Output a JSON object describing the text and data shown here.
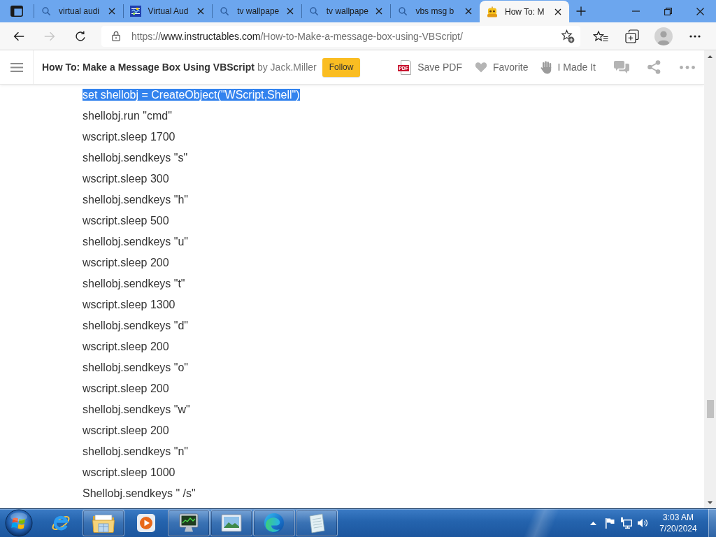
{
  "tabs": [
    {
      "kind": "search",
      "label": "virtual audi",
      "selected": false
    },
    {
      "kind": "app",
      "label": "Virtual Aud",
      "selected": false
    },
    {
      "kind": "search",
      "label": "tv wallpape",
      "selected": false
    },
    {
      "kind": "search",
      "label": "tv wallpape",
      "selected": false
    },
    {
      "kind": "search",
      "label": "vbs msg b",
      "selected": false
    },
    {
      "kind": "site",
      "label": "How To: M",
      "selected": true
    }
  ],
  "toolbar": {
    "nav_buttons": [
      {
        "kind": "back",
        "disabled": false
      },
      {
        "kind": "forward",
        "disabled": true
      },
      {
        "kind": "refresh",
        "disabled": false
      }
    ],
    "address": {
      "scheme": "https://",
      "host": "www.instructables.com",
      "path": "/How-to-Make-a-message-box-using-VBScript/"
    }
  },
  "article_header": {
    "title": "How To: Make a Message Box Using VBScript",
    "byline": "by Jack.Miller",
    "follow_button": "Follow",
    "actions": [
      {
        "kind": "pdf",
        "icon_text": "PDF",
        "label": "Save PDF"
      },
      {
        "kind": "heart",
        "label": "Favorite"
      },
      {
        "kind": "hand",
        "label": "I Made It"
      }
    ]
  },
  "code_lines": [
    {
      "text": "set shellobj = CreateObject(\"WScript.Shell\")",
      "selected": true
    },
    {
      "text": "shellobj.run \"cmd\"",
      "selected": false
    },
    {
      "text": "wscript.sleep 1700",
      "selected": false
    },
    {
      "text": "shellobj.sendkeys \"s\"",
      "selected": false
    },
    {
      "text": "wscript.sleep 300",
      "selected": false
    },
    {
      "text": "shellobj.sendkeys \"h\"",
      "selected": false
    },
    {
      "text": "wscript.sleep 500",
      "selected": false
    },
    {
      "text": "shellobj.sendkeys \"u\"",
      "selected": false
    },
    {
      "text": "wscript.sleep 200",
      "selected": false
    },
    {
      "text": "shellobj.sendkeys \"t\"",
      "selected": false
    },
    {
      "text": "wscript.sleep 1300",
      "selected": false
    },
    {
      "text": "shellobj.sendkeys \"d\"",
      "selected": false
    },
    {
      "text": "wscript.sleep 200",
      "selected": false
    },
    {
      "text": "shellobj.sendkeys \"o\"",
      "selected": false
    },
    {
      "text": "wscript.sleep 200",
      "selected": false
    },
    {
      "text": "shellobj.sendkeys \"w\"",
      "selected": false
    },
    {
      "text": "wscript.sleep 200",
      "selected": false
    },
    {
      "text": "shellobj.sendkeys \"n\"",
      "selected": false
    },
    {
      "text": "wscript.sleep 1000",
      "selected": false
    },
    {
      "text": "Shellobj.sendkeys \" /s\"",
      "selected": false
    }
  ],
  "taskbar": {
    "apps": [
      {
        "kind": "ie",
        "running": false
      },
      {
        "kind": "explorer",
        "running": true
      },
      {
        "kind": "media_player",
        "running": false
      },
      {
        "kind": "system_monitor",
        "running": true
      },
      {
        "kind": "photo_viewer",
        "running": true
      },
      {
        "kind": "edge",
        "running": true
      },
      {
        "kind": "notepad",
        "running": true
      }
    ],
    "clock": {
      "time": "3:03 AM",
      "date": "7/20/2024"
    }
  }
}
